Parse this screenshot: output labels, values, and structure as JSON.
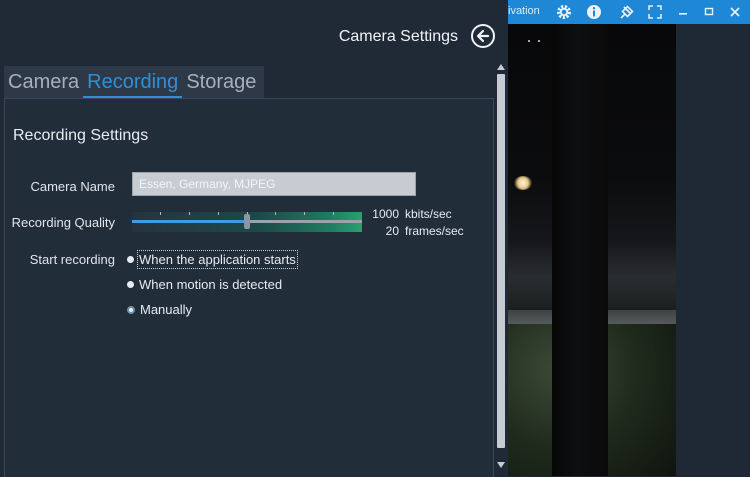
{
  "panel": {
    "title": "Camera Settings",
    "back_icon": "arrow-left-circle-icon",
    "tabs": [
      {
        "label": "Camera",
        "active": false
      },
      {
        "label": "Recording",
        "active": true
      },
      {
        "label": "Storage",
        "active": false
      }
    ]
  },
  "recording": {
    "section_title": "Recording Settings",
    "camera_name_label": "Camera Name",
    "camera_name_value": "Essen, Germany, MJPEG",
    "quality_label": "Recording Quality",
    "quality_level": 0.5,
    "bitrate_value": "1000",
    "bitrate_unit": "kbits/sec",
    "framerate_value": "20",
    "framerate_unit": "frames/sec",
    "start_label": "Start recording",
    "start_options": [
      {
        "label": "When the application starts",
        "checked": false
      },
      {
        "label": "When motion is detected",
        "checked": false
      },
      {
        "label": "Manually",
        "checked": true
      }
    ]
  },
  "camera_window": {
    "title_fragment": "ivation",
    "icons": [
      "gear-icon",
      "info-icon",
      "pin-icon",
      "fullscreen-icon",
      "minimize-icon",
      "maximize-icon",
      "close-icon"
    ]
  },
  "colors": {
    "accent": "#2f8fd5",
    "titlebar": "#1e88d6",
    "panel_bg": "#202a36"
  }
}
